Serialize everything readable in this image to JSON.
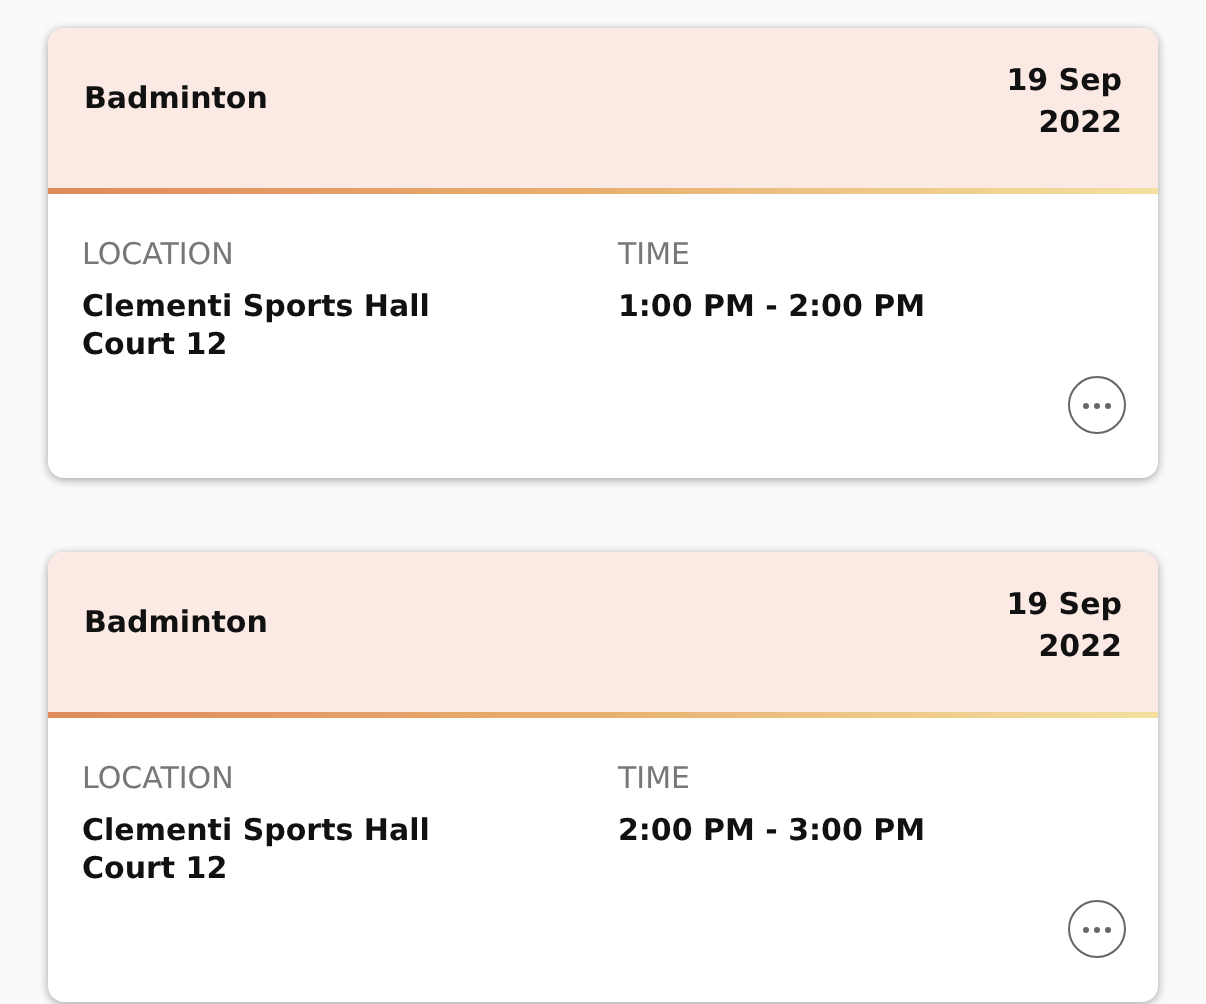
{
  "bookings": [
    {
      "sport": "Badminton",
      "date_day": "19 Sep",
      "date_year": "2022",
      "location_label": "LOCATION",
      "location_lines": [
        "Clementi Sports Hall",
        "Court 12"
      ],
      "time_label": "TIME",
      "time": "1:00 PM - 2:00 PM"
    },
    {
      "sport": "Badminton",
      "date_day": "19 Sep",
      "date_year": "2022",
      "location_label": "LOCATION",
      "location_lines": [
        "Clementi Sports Hall",
        "Court 12"
      ],
      "time_label": "TIME",
      "time": "2:00 PM - 3:00 PM"
    }
  ]
}
